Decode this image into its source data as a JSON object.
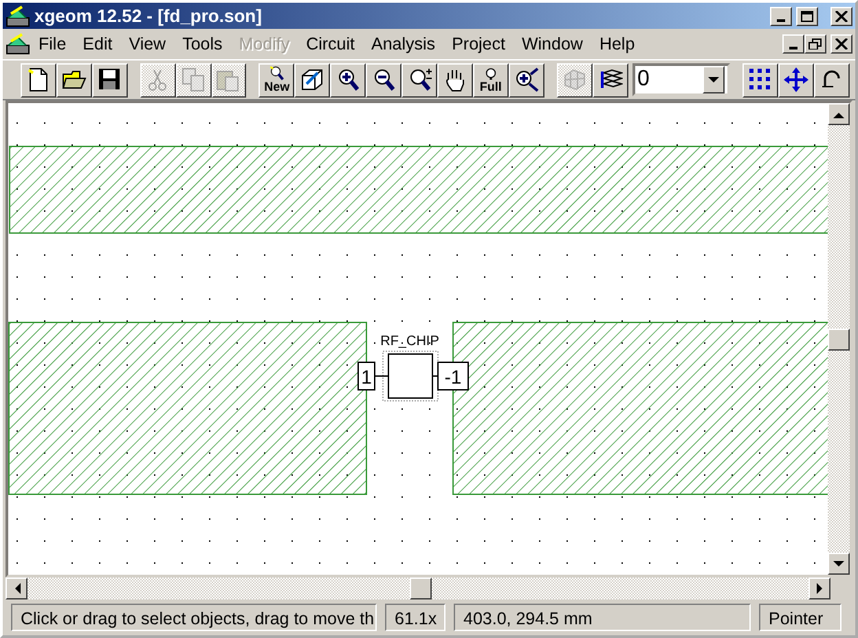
{
  "window": {
    "title": "xgeom 12.52 - [fd_pro.son]"
  },
  "menu": [
    {
      "label": "File",
      "disabled": false
    },
    {
      "label": "Edit",
      "disabled": false
    },
    {
      "label": "View",
      "disabled": false
    },
    {
      "label": "Tools",
      "disabled": false
    },
    {
      "label": "Modify",
      "disabled": true
    },
    {
      "label": "Circuit",
      "disabled": false
    },
    {
      "label": "Analysis",
      "disabled": false
    },
    {
      "label": "Project",
      "disabled": false
    },
    {
      "label": "Window",
      "disabled": false
    },
    {
      "label": "Help",
      "disabled": false
    }
  ],
  "toolbar": [
    [
      {
        "kind": "page",
        "disabled": false
      },
      {
        "kind": "folder",
        "disabled": false
      },
      {
        "kind": "disk",
        "disabled": false
      }
    ],
    [
      {
        "kind": "scissors",
        "disabled": true
      },
      {
        "kind": "copy",
        "disabled": true
      },
      {
        "kind": "paste",
        "disabled": true
      }
    ],
    [
      {
        "kind": "zoomnew",
        "disabled": false,
        "label": "New"
      },
      {
        "kind": "cube",
        "disabled": false
      },
      {
        "kind": "zoomin",
        "disabled": false
      },
      {
        "kind": "zoomout",
        "disabled": false
      },
      {
        "kind": "zoompm",
        "disabled": false
      },
      {
        "kind": "hand",
        "disabled": false
      },
      {
        "kind": "zoomfull",
        "disabled": false,
        "label": "Full"
      },
      {
        "kind": "zoomarrow",
        "disabled": false
      }
    ],
    [
      {
        "kind": "mesh",
        "disabled": true
      },
      {
        "kind": "layers",
        "disabled": false
      },
      {
        "kind": "combo",
        "value": "0"
      }
    ],
    [
      {
        "kind": "dots",
        "disabled": false
      },
      {
        "kind": "move",
        "disabled": false
      },
      {
        "kind": "partial",
        "disabled": false
      }
    ]
  ],
  "canvas": {
    "component": {
      "name": "RF_CHIP",
      "ports": [
        "1",
        "-1"
      ]
    }
  },
  "status_bar": [
    "Click or drag to select objects, drag to move th",
    "61.1x",
    "403.0, 294.5 mm",
    "Pointer"
  ]
}
